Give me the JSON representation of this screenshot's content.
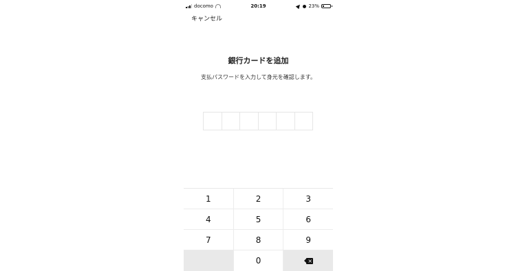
{
  "status_bar": {
    "carrier": "docomo",
    "time": "20:19",
    "battery": "23%",
    "battery_level": 0.23
  },
  "header": {
    "cancel_label": "キャンセル"
  },
  "main": {
    "title": "銀行カードを追加",
    "subtitle": "支払パスワードを入力して身元を確認します。",
    "pin_length": 6
  },
  "keypad": {
    "keys": [
      "1",
      "2",
      "3",
      "4",
      "5",
      "6",
      "7",
      "8",
      "9",
      "",
      "0",
      "delete"
    ]
  },
  "icons": {
    "signal": "signal-icon",
    "wifi": "wifi-icon",
    "location": "location-arrow-icon",
    "alarm": "alarm-icon",
    "battery": "battery-icon",
    "delete": "backspace-icon"
  }
}
